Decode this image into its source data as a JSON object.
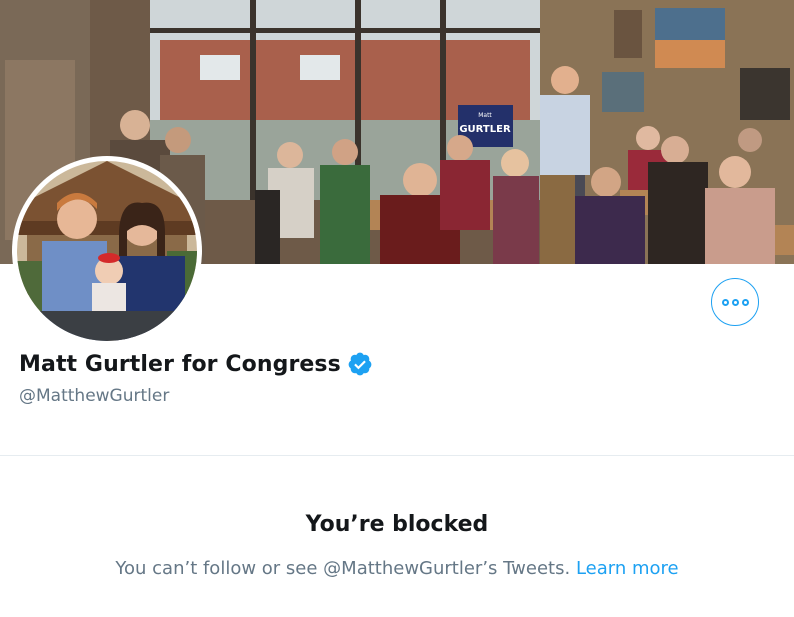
{
  "profile": {
    "name": "Matt Gurtler for Congress",
    "handle": "@MatthewGurtler",
    "verified": true
  },
  "banner": {
    "sign_text_top": "Matt",
    "sign_text_main": "GURTLER"
  },
  "blocked": {
    "title": "You’re blocked",
    "message": "You can’t follow or see @MatthewGurtler’s Tweets.",
    "link": "Learn more"
  },
  "icons": {
    "more": "more-options-icon",
    "verified": "verified-badge-icon"
  },
  "colors": {
    "accent": "#1da1f2",
    "text": "#14171a",
    "secondary": "#657786"
  }
}
